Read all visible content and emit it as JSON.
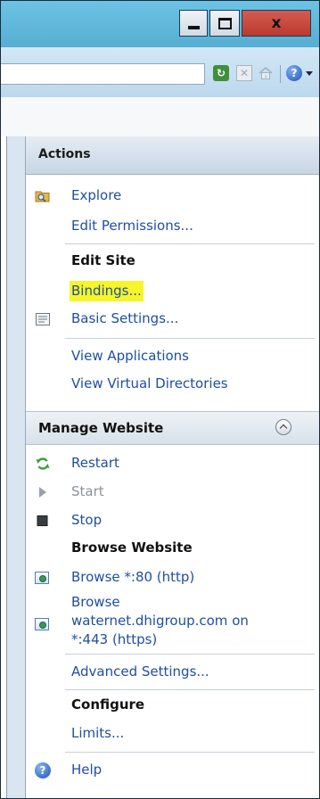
{
  "window": {
    "minimize_glyph": "",
    "maximize_glyph": "",
    "close_glyph": "x"
  },
  "toolbar": {
    "icons": [
      "refresh-icon",
      "stop-icon",
      "home-icon",
      "help-icon",
      "dropdown-arrow-icon"
    ]
  },
  "actions": {
    "header": "Actions",
    "explore": "Explore",
    "edit_permissions": "Edit Permissions...",
    "edit_site_heading": "Edit Site",
    "bindings": "Bindings...",
    "basic_settings": "Basic Settings...",
    "view_applications": "View Applications",
    "view_virtual_directories": "View Virtual Directories",
    "manage_website": "Manage Website",
    "restart": "Restart",
    "start": "Start",
    "stop": "Stop",
    "browse_website_heading": "Browse Website",
    "browse_http": "Browse *:80 (http)",
    "browse_https_line1": "Browse",
    "browse_https_line2": "waternet.dhigroup.com on",
    "browse_https_line3": "*:443 (https)",
    "advanced_settings": "Advanced Settings...",
    "configure_heading": "Configure",
    "limits": "Limits...",
    "help": "Help"
  },
  "colors": {
    "link": "#1f4fa0",
    "highlight": "#f5f52a",
    "close_button": "#c5473b",
    "titlebar": "#5fb6d8"
  }
}
